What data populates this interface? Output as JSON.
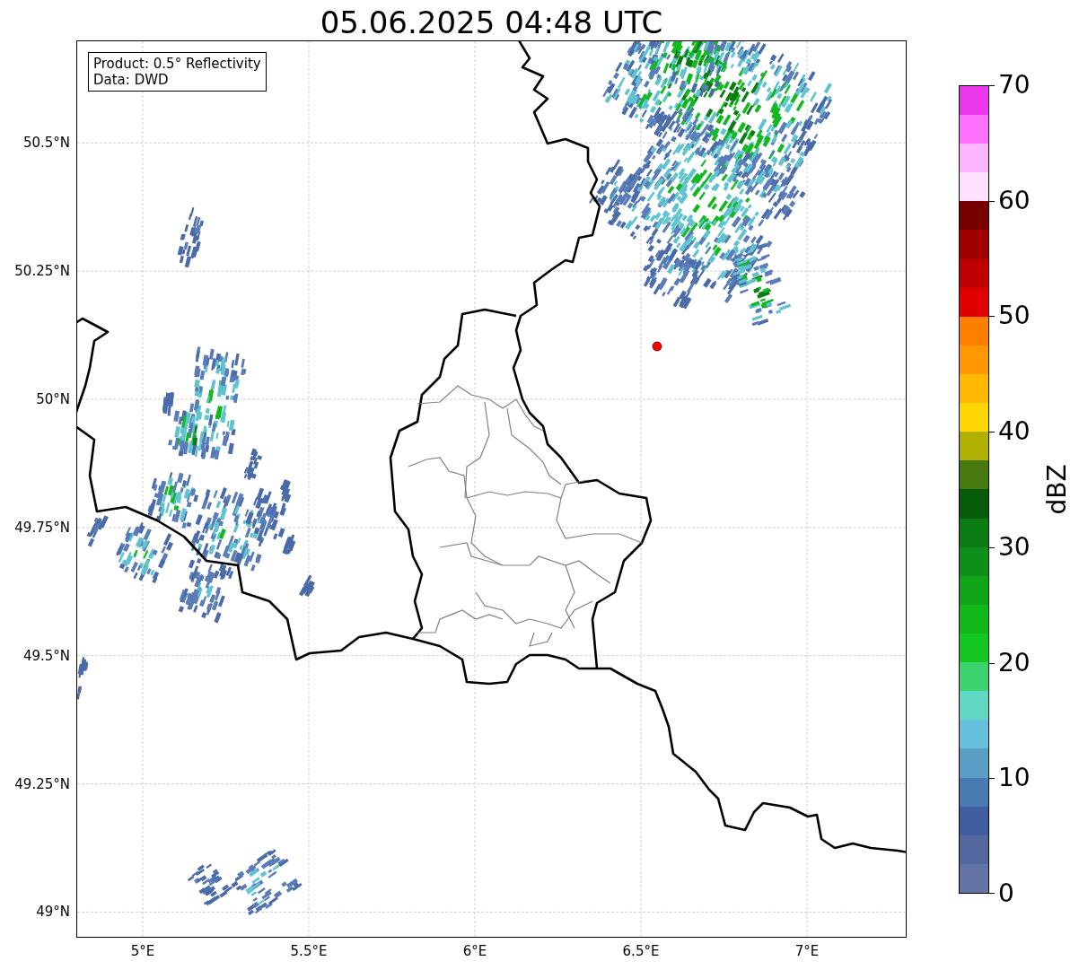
{
  "title": "05.06.2025 04:48 UTC",
  "info_box": {
    "lines": [
      "Product: 0.5° Reflectivity",
      "Data: DWD"
    ]
  },
  "y_ticks": [
    "50.5°N",
    "50.25°N",
    "50°N",
    "49.75°N",
    "49.5°N",
    "49.25°N",
    "49°N"
  ],
  "x_ticks": [
    "5°E",
    "5.5°E",
    "6°E",
    "6.5°E",
    "7°E"
  ],
  "colorbar": {
    "label": "dBZ",
    "ticks": [
      "70",
      "60",
      "50",
      "40",
      "30",
      "20",
      "10",
      "0"
    ],
    "bands": [
      {
        "color": "#6474a6"
      },
      {
        "color": "#5468a0"
      },
      {
        "color": "#425ea0"
      },
      {
        "color": "#4a7ab2"
      },
      {
        "color": "#5a9ec6"
      },
      {
        "color": "#66c2dc"
      },
      {
        "color": "#60d8c4"
      },
      {
        "color": "#3cd470"
      },
      {
        "color": "#12c820"
      },
      {
        "color": "#10b81a"
      },
      {
        "color": "#10a418"
      },
      {
        "color": "#0e9018"
      },
      {
        "color": "#0a7c12"
      },
      {
        "color": "#065c08"
      },
      {
        "color": "#487810"
      },
      {
        "color": "#b0b000"
      },
      {
        "color": "#ffd700"
      },
      {
        "color": "#ffb800"
      },
      {
        "color": "#ff9800"
      },
      {
        "color": "#ff7f00"
      },
      {
        "color": "#e00000"
      },
      {
        "color": "#c00000"
      },
      {
        "color": "#a00000"
      },
      {
        "color": "#780000"
      },
      {
        "color": "#ffe0ff"
      },
      {
        "color": "#ffb4ff"
      },
      {
        "color": "#ff70ff"
      },
      {
        "color": "#ea38ea"
      }
    ]
  }
}
